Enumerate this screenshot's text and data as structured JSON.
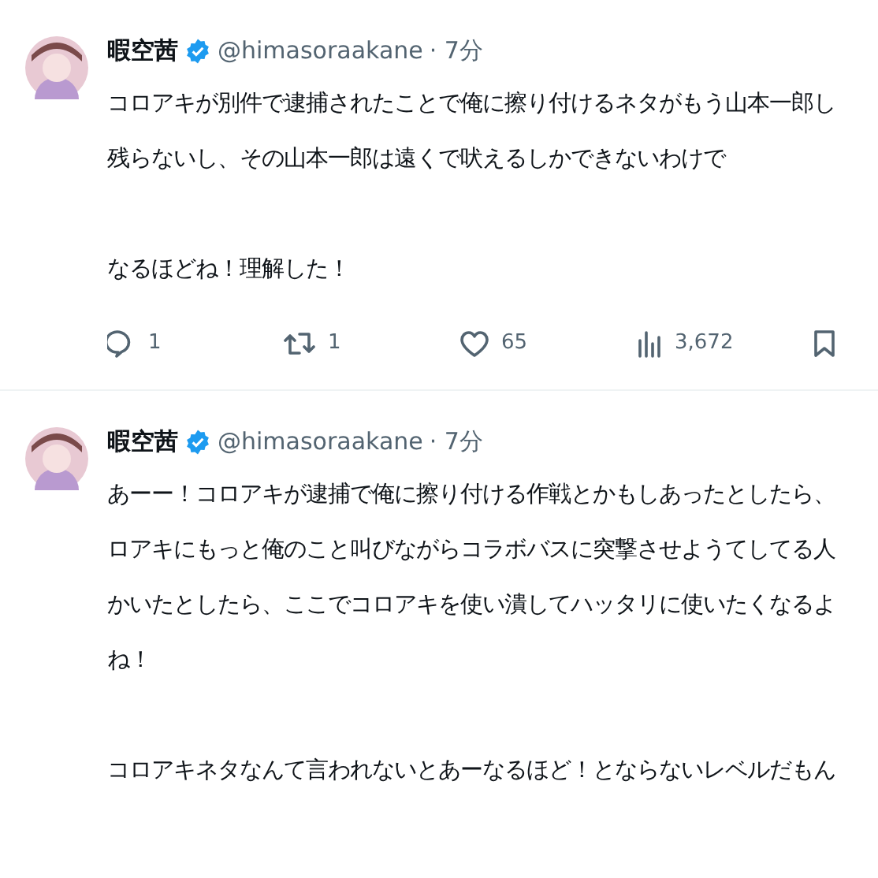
{
  "tweets": [
    {
      "name": "暇空茜",
      "verified": true,
      "handle": "@himasoraakane",
      "time": "· 7分",
      "paragraphs": [
        [
          "コロアキが別件で逮捕されたことで俺に擦り付けるネタがもう山本一郎し",
          "残らないし、その山本一郎は遠くで吠えるしかできないわけで"
        ],
        [
          "なるほどね！理解した！"
        ]
      ],
      "actions": {
        "replies": "1",
        "reposts": "1",
        "likes": "65",
        "views": "3,672"
      }
    },
    {
      "name": "暇空茜",
      "verified": true,
      "handle": "@himasoraakane",
      "time": "· 7分",
      "paragraphs": [
        [
          "あーー！コロアキが逮捕で俺に擦り付ける作戦とかもしあったとしたら、",
          "ロアキにもっと俺のこと叫びながらコラボバスに突撃させようてしてる人",
          "かいたとしたら、ここでコロアキを使い潰してハッタリに使いたくなるよ",
          "ね！"
        ],
        [
          "コロアキネタなんて言われないとあーなるほど！とならないレベルだもん"
        ]
      ]
    }
  ]
}
